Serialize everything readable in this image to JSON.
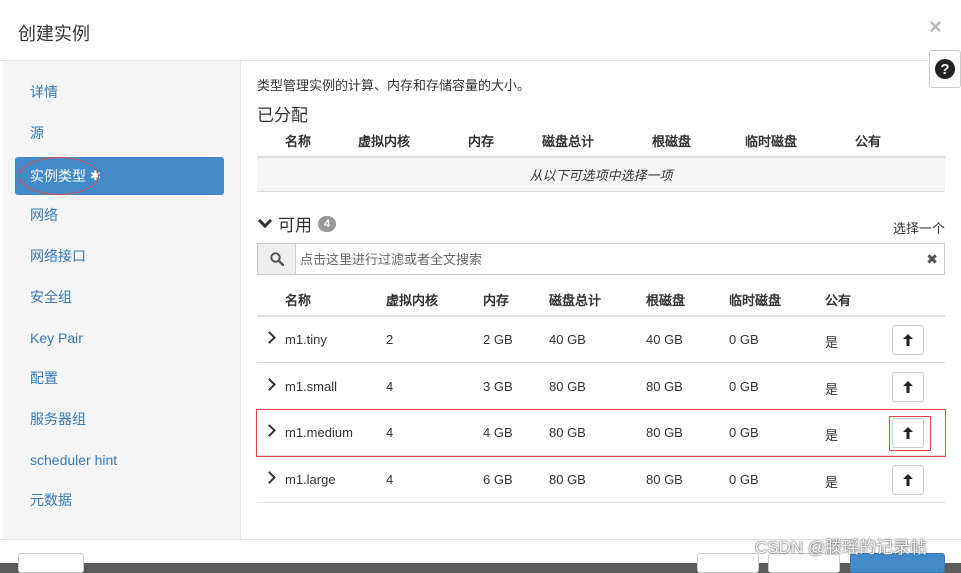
{
  "modal": {
    "title": "创建实例",
    "close": "×",
    "help": "?"
  },
  "sidebar": {
    "items": [
      {
        "label": "详情"
      },
      {
        "label": "源"
      },
      {
        "label": "实例类型",
        "required_mark": "✱",
        "active": true
      },
      {
        "label": "网络"
      },
      {
        "label": "网络接口"
      },
      {
        "label": "安全组"
      },
      {
        "label": "Key Pair"
      },
      {
        "label": "配置"
      },
      {
        "label": "服务器组"
      },
      {
        "label": "scheduler hint"
      },
      {
        "label": "元数据"
      }
    ]
  },
  "main": {
    "description": "类型管理实例的计算、内存和存储容量的大小。",
    "allocated": {
      "title": "已分配",
      "columns": [
        "名称",
        "虚拟内核",
        "内存",
        "磁盘总计",
        "根磁盘",
        "临时磁盘",
        "公有"
      ],
      "empty_text": "从以下可选项中选择一项"
    },
    "available": {
      "title": "可用",
      "count": "4",
      "pick_label": "选择一个",
      "search_placeholder": "点击这里进行过滤或者全文搜索",
      "search_value": "",
      "columns": [
        "名称",
        "虚拟内核",
        "内存",
        "磁盘总计",
        "根磁盘",
        "临时磁盘",
        "公有"
      ],
      "rows": [
        {
          "name": "m1.tiny",
          "vcpus": "2",
          "ram": "2 GB",
          "disk_total": "40 GB",
          "root_disk": "40 GB",
          "ephemeral": "0 GB",
          "public": "是"
        },
        {
          "name": "m1.small",
          "vcpus": "4",
          "ram": "3 GB",
          "disk_total": "80 GB",
          "root_disk": "80 GB",
          "ephemeral": "0 GB",
          "public": "是"
        },
        {
          "name": "m1.medium",
          "vcpus": "4",
          "ram": "4 GB",
          "disk_total": "80 GB",
          "root_disk": "80 GB",
          "ephemeral": "0 GB",
          "public": "是"
        },
        {
          "name": "m1.large",
          "vcpus": "4",
          "ram": "6 GB",
          "disk_total": "80 GB",
          "root_disk": "80 GB",
          "ephemeral": "0 GB",
          "public": "是"
        }
      ]
    }
  },
  "watermark": "CSDN @滕瑶的记录帖",
  "colors": {
    "accent": "#428bca",
    "highlight": "#e04848",
    "link": "#337ab7"
  },
  "icons": {
    "search": "search-icon",
    "up": "arrow-up-icon",
    "expand": "chevron-right-icon"
  }
}
